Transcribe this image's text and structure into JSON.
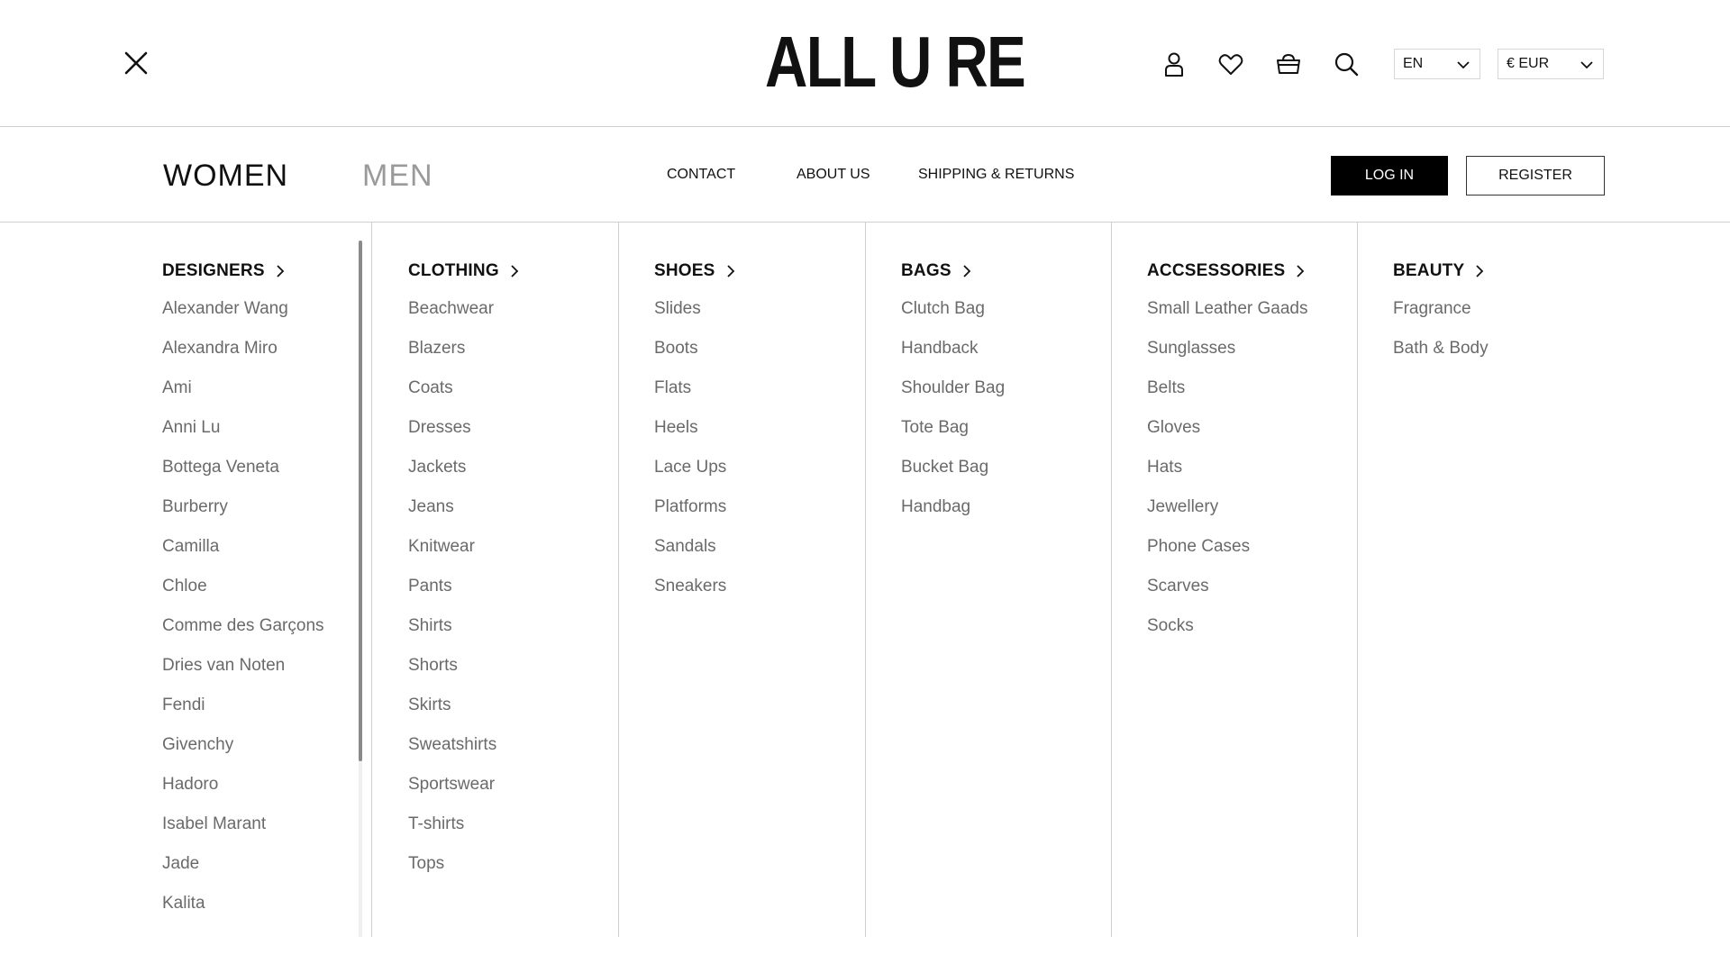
{
  "header": {
    "logo": "ALL U RE",
    "language": "EN",
    "currency": "€ EUR",
    "icons": [
      "close-icon",
      "user-icon",
      "heart-icon",
      "basket-icon",
      "search-icon",
      "chevron-down-icon"
    ]
  },
  "nav": {
    "women": "WOMEN",
    "men": "MEN",
    "links": [
      "CONTACT",
      "ABOUT US",
      "SHIPPING & RETURNS"
    ],
    "login": "LOG IN",
    "register": "REGISTER"
  },
  "menu": {
    "designers": {
      "title": "DESIGNERS",
      "items": [
        "Alexander Wang",
        "Alexandra Miro",
        "Ami",
        "Anni Lu",
        "Bottega Veneta",
        "Burberry",
        "Camilla",
        "Chloe",
        "Comme des Garçons",
        "Dries van Noten",
        "Fendi",
        "Givenchy",
        "Hadoro",
        "Isabel Marant",
        "Jade",
        "Kalita"
      ]
    },
    "clothing": {
      "title": "CLOTHING",
      "items": [
        "Beachwear",
        "Blazers",
        "Coats",
        "Dresses",
        "Jackets",
        "Jeans",
        "Knitwear",
        "Pants",
        "Shirts",
        "Shorts",
        "Skirts",
        "Sweatshirts",
        "Sportswear",
        "T-shirts",
        "Tops"
      ]
    },
    "shoes": {
      "title": "SHOES",
      "items": [
        "Slides",
        "Boots",
        "Flats",
        "Heels",
        "Lace Ups",
        "Platforms",
        "Sandals",
        "Sneakers"
      ]
    },
    "bags": {
      "title": "BAGS",
      "items": [
        "Clutch Bag",
        "Handback",
        "Shoulder Bag",
        "Tote Bag",
        "Bucket Bag",
        "Handbag"
      ]
    },
    "accessories": {
      "title": "ACCSESSORIES",
      "items": [
        "Small Leather Gaads",
        "Sunglasses",
        "Belts",
        "Gloves",
        "Hats",
        "Jewellery",
        "Phone Cases",
        "Scarves",
        "Socks"
      ]
    },
    "beauty": {
      "title": "BEAUTY",
      "items": [
        "Fragrance",
        "Bath & Body"
      ]
    }
  }
}
